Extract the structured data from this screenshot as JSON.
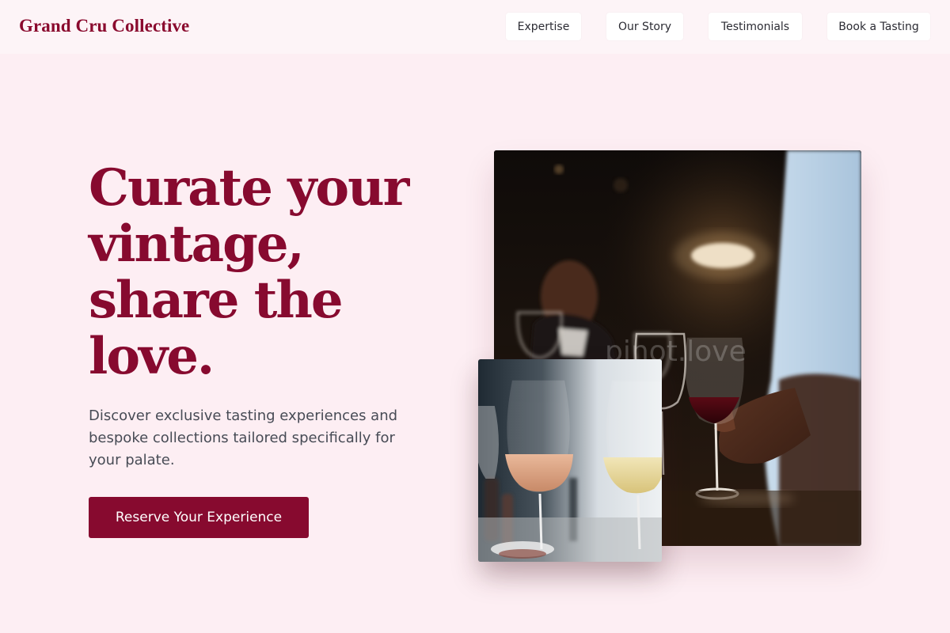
{
  "brand": {
    "name": "Grand Cru Collective"
  },
  "nav": {
    "items": [
      {
        "label": "Expertise"
      },
      {
        "label": "Our Story"
      },
      {
        "label": "Testimonials"
      },
      {
        "label": "Book a Tasting"
      }
    ]
  },
  "hero": {
    "title": "Curate your vintage, share the love.",
    "subtitle": "Discover exclusive tasting experiences and bespoke collections tailored specifically for your palate.",
    "cta_label": "Reserve Your Experience"
  },
  "images": {
    "main_photo": "wine-tasting-bar-photo",
    "secondary_photo": "rose-and-white-wine-glasses-photo",
    "main_photo_watermark": "pinot.love"
  },
  "colors": {
    "page_background": "#fdeef3",
    "header_background": "#fdf4f7",
    "brand_burgundy": "#870a2f",
    "body_text": "#474b55"
  }
}
